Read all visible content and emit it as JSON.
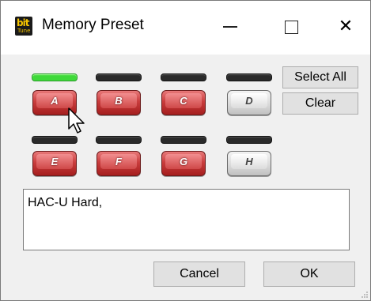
{
  "window": {
    "title": "Memory Preset",
    "icon": "bittune-app-icon",
    "icon_text_top": "bit",
    "icon_text_bottom": "Tune",
    "controls": [
      "minimize-icon",
      "maximize-icon",
      "close-icon"
    ],
    "close_glyph": "✕"
  },
  "presets": [
    {
      "label": "A",
      "enabled": true,
      "led": "on",
      "color": "#c93d3d"
    },
    {
      "label": "B",
      "enabled": true,
      "led": "off",
      "color": "#c93d3d"
    },
    {
      "label": "C",
      "enabled": true,
      "led": "off",
      "color": "#c93d3d"
    },
    {
      "label": "D",
      "enabled": false,
      "led": "off",
      "color": "#d8d8d8"
    },
    {
      "label": "E",
      "enabled": true,
      "led": "off",
      "color": "#c93d3d"
    },
    {
      "label": "F",
      "enabled": true,
      "led": "off",
      "color": "#c93d3d"
    },
    {
      "label": "G",
      "enabled": true,
      "led": "off",
      "color": "#c93d3d"
    },
    {
      "label": "H",
      "enabled": false,
      "led": "off",
      "color": "#d8d8d8"
    }
  ],
  "side_buttons": {
    "select_all": "Select All",
    "clear": "Clear"
  },
  "memo": {
    "value": "HAC-U Hard,"
  },
  "footer": {
    "cancel": "Cancel",
    "ok": "OK"
  },
  "colors": {
    "led_on": "#3fd93a",
    "led_off": "#2a2a2a",
    "dialog_bg": "#f0f0f0"
  }
}
